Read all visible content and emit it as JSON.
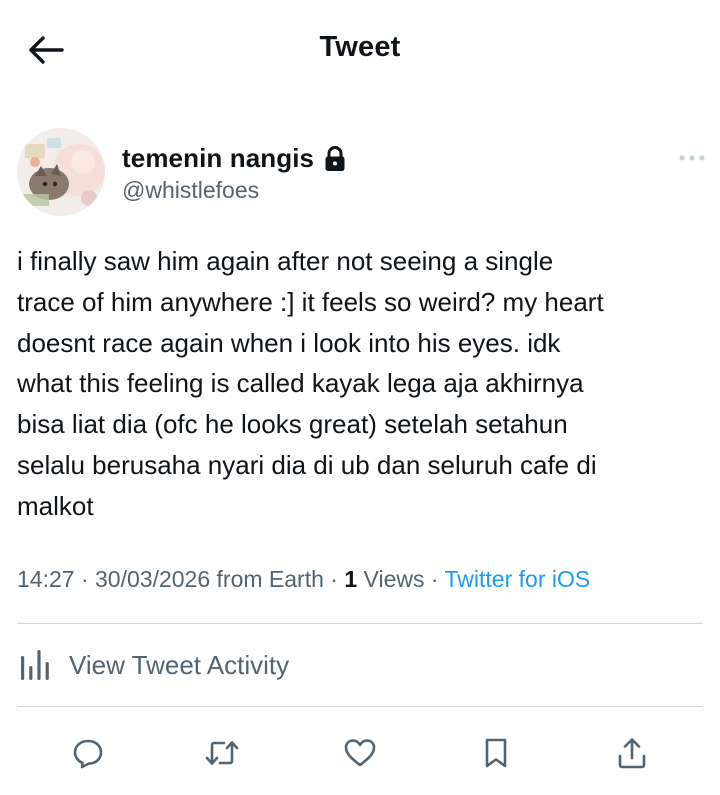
{
  "header": {
    "title": "Tweet",
    "back_icon": "arrow-left-icon"
  },
  "author": {
    "display_name": "temenin nangis",
    "handle": "@whistlefoes",
    "protected_icon": "lock-icon"
  },
  "tweet": {
    "text": "i finally saw him again after not seeing a single\ntrace of him anywhere :] it feels so weird? my heart\ndoesnt race again when i look into his eyes. idk\nwhat this feeling is called kayak lega aja akhirnya\nbisa liat dia (ofc he looks great) setelah setahun\nselalu berusaha nyari dia di ub dan seluruh cafe di\nmalkot",
    "time": "14:27",
    "date": "30/03/2026",
    "location_text": "from Earth",
    "separator": " · ",
    "views_count": "1",
    "views_label": "Views",
    "source": "Twitter for iOS"
  },
  "activity": {
    "label": "View Tweet Activity",
    "icon": "bar-chart-icon"
  },
  "actions": [
    {
      "name": "reply",
      "icon": "reply-icon"
    },
    {
      "name": "retweet",
      "icon": "retweet-icon"
    },
    {
      "name": "like",
      "icon": "heart-icon"
    },
    {
      "name": "bookmark",
      "icon": "bookmark-icon"
    },
    {
      "name": "share",
      "icon": "share-icon"
    }
  ],
  "colors": {
    "text_primary": "#0f1419",
    "text_secondary": "#536471",
    "link": "#1d9bf0",
    "divider": "#cfd9de"
  }
}
